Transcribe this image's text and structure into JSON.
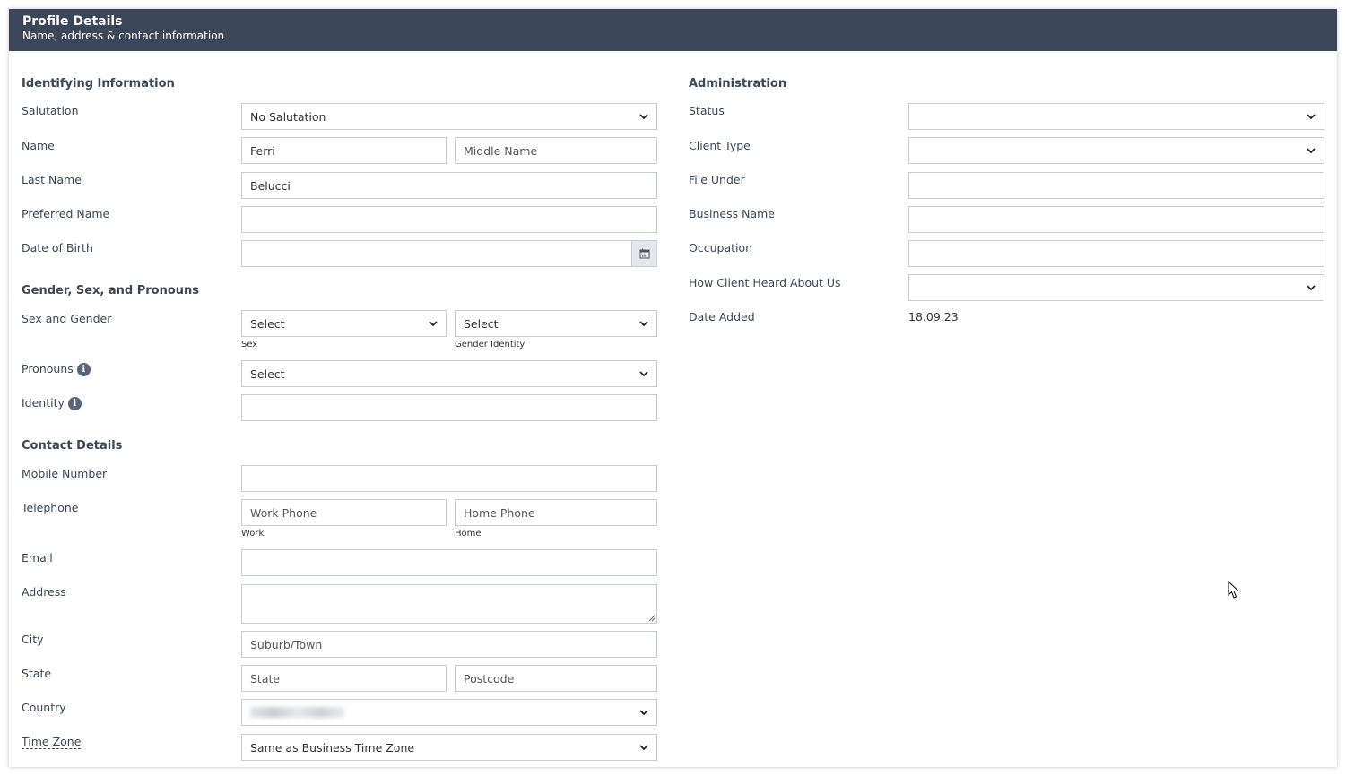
{
  "header": {
    "title": "Profile Details",
    "subtitle": "Name, address & contact information"
  },
  "left": {
    "identifying": {
      "title": "Identifying Information",
      "salutation_label": "Salutation",
      "salutation_value": "No Salutation",
      "name_label": "Name",
      "first_name_value": "Ferri",
      "middle_name_placeholder": "Middle Name",
      "last_name_label": "Last Name",
      "last_name_value": "Belucci",
      "preferred_name_label": "Preferred Name",
      "dob_label": "Date of Birth"
    },
    "gender": {
      "title": "Gender, Sex, and Pronouns",
      "sex_gender_label": "Sex and Gender",
      "sex_value": "Select",
      "sex_sublabel": "Sex",
      "gender_value": "Select",
      "gender_sublabel": "Gender Identity",
      "pronouns_label": "Pronouns",
      "pronouns_value": "Select",
      "identity_label": "Identity"
    },
    "contact": {
      "title": "Contact Details",
      "mobile_label": "Mobile Number",
      "telephone_label": "Telephone",
      "work_phone_placeholder": "Work Phone",
      "work_sublabel": "Work",
      "home_phone_placeholder": "Home Phone",
      "home_sublabel": "Home",
      "email_label": "Email",
      "address_label": "Address",
      "city_label": "City",
      "city_placeholder": "Suburb/Town",
      "state_label": "State",
      "state_placeholder": "State",
      "postcode_placeholder": "Postcode",
      "country_label": "Country",
      "timezone_label": "Time Zone",
      "timezone_value": "Same as Business Time Zone"
    }
  },
  "right": {
    "title": "Administration",
    "status_label": "Status",
    "client_type_label": "Client Type",
    "file_under_label": "File Under",
    "business_name_label": "Business Name",
    "occupation_label": "Occupation",
    "heard_label": "How Client Heard About Us",
    "date_added_label": "Date Added",
    "date_added_value": "18.09.23"
  },
  "icons": {
    "chevron": "chevron-down-icon",
    "calendar": "calendar-icon",
    "info": "info-icon",
    "cursor": "mouse-cursor-icon"
  },
  "colors": {
    "header_bg": "#3b4658",
    "label": "#3b4658",
    "border": "#c9ccd1"
  }
}
